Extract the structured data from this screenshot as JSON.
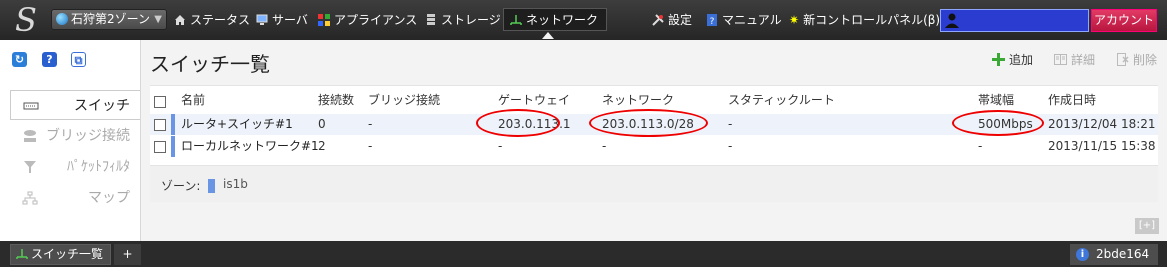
{
  "topbar": {
    "zone_select": "石狩第2ゾーン",
    "menu": [
      "ステータス",
      "サーバ",
      "アプライアンス",
      "ストレージ",
      "ネットワーク"
    ],
    "active_menu": "ネットワーク",
    "settings": "設定",
    "manual": "マニュアル",
    "new_control_panel": "新コントロールパネル(β)",
    "account": "アカウント"
  },
  "sidebar": {
    "items": [
      {
        "label": "スイッチ",
        "icon": "switch-icon",
        "active": true
      },
      {
        "label": "ブリッジ接続",
        "icon": "bridge-icon",
        "active": false
      },
      {
        "label": "ﾊﾟｹｯﾄﾌｨﾙﾀ",
        "icon": "filter-icon",
        "active": false
      },
      {
        "label": "マップ",
        "icon": "map-icon",
        "active": false
      }
    ]
  },
  "main": {
    "title": "スイッチ一覧",
    "actions": {
      "add": "追加",
      "detail": "詳細",
      "delete": "削除"
    },
    "columns": [
      "名前",
      "接続数",
      "ブリッジ接続",
      "ゲートウェイ",
      "ネットワーク",
      "スタティックルート",
      "帯域幅",
      "作成日時"
    ],
    "rows": [
      [
        "ルータ+スイッチ#1",
        "0",
        "-",
        "203.0.113.1",
        "203.0.113.0/28",
        "-",
        "500Mbps",
        "2013/12/04 18:21"
      ],
      [
        "ローカルネットワーク#1",
        "2",
        "-",
        "-",
        "-",
        "-",
        "-",
        "2013/11/15 15:38"
      ]
    ],
    "zone_label": "ゾーン:",
    "zone_value": "is1b",
    "expand": "[+]"
  },
  "taskbar": {
    "task": "スイッチ一覧",
    "add": "+",
    "session": "2bde164"
  },
  "colors": {
    "highlight_circle": "#e00000",
    "accent_blue": "#6a94e4",
    "account_button": "#d21f4d"
  }
}
